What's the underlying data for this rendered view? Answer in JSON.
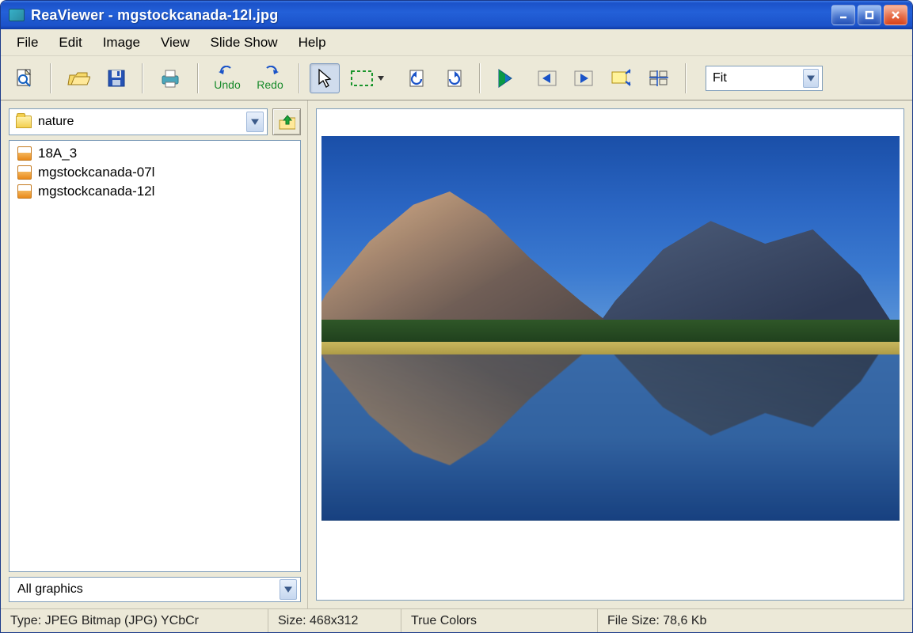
{
  "title": "ReaViewer - mgstockcanada-12l.jpg",
  "menu": {
    "items": [
      "File",
      "Edit",
      "Image",
      "View",
      "Slide Show",
      "Help"
    ]
  },
  "toolbar": {
    "undo_label": "Undo",
    "redo_label": "Redo",
    "zoom_value": "Fit"
  },
  "sidebar": {
    "folder": "nature",
    "files": [
      "18A_3",
      "mgstockcanada-07l",
      "mgstockcanada-12l"
    ],
    "filter": "All graphics"
  },
  "status": {
    "type": "Type: JPEG Bitmap (JPG) YCbCr",
    "size": "Size: 468x312",
    "colors": "True Colors",
    "filesize": "File Size: 78,6 Kb"
  },
  "colors": {
    "accent": "#2360d8"
  }
}
